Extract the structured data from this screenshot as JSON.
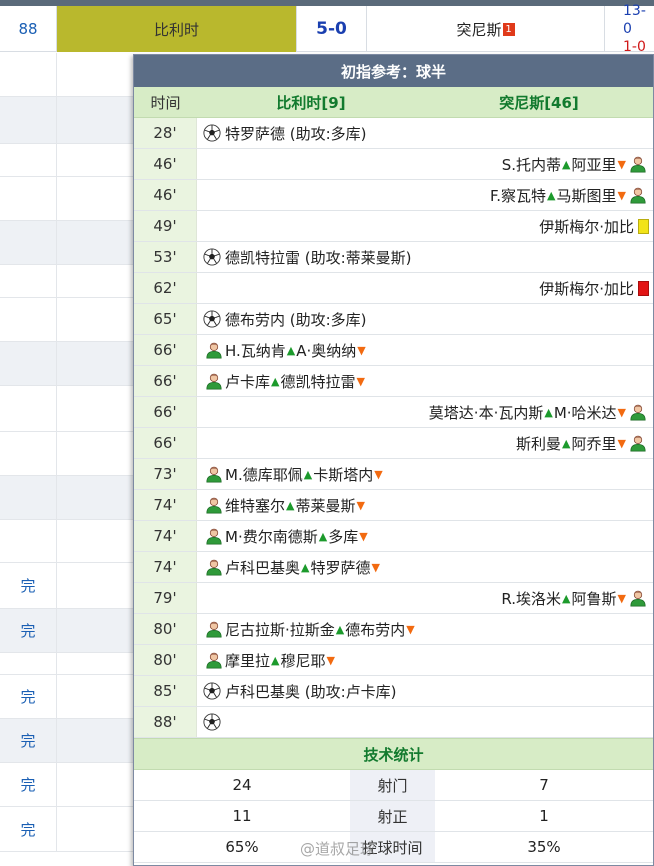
{
  "match_row": {
    "time": "88",
    "home_team": "比利时",
    "score": "5-0",
    "away_team": "突尼斯",
    "away_badge": "1",
    "half_1": "13-0",
    "half_2": "1-0"
  },
  "background_rows": [
    {
      "status": ""
    },
    {
      "status": ""
    },
    {
      "status": ""
    },
    {
      "status": ""
    },
    {
      "status": ""
    },
    {
      "status": ""
    },
    {
      "status": ""
    },
    {
      "status": ""
    },
    {
      "status": ""
    },
    {
      "status": ""
    },
    {
      "status": ""
    },
    {
      "status": ""
    },
    {
      "status": "完"
    },
    {
      "status": "完"
    },
    {
      "status": ""
    },
    {
      "status": "完"
    },
    {
      "status": "完"
    },
    {
      "status": "完"
    },
    {
      "status": "完"
    }
  ],
  "popup": {
    "title": "初指参考：球半",
    "col_time": "时间",
    "col_home": "比利时[9]",
    "col_away": "突尼斯[46]",
    "events": [
      {
        "time": "28'",
        "side": "home",
        "type": "goal",
        "text": "特罗萨德 (助攻:多库)"
      },
      {
        "time": "46'",
        "side": "away",
        "type": "sub",
        "in": "S.托内蒂",
        "out": "阿亚里"
      },
      {
        "time": "46'",
        "side": "away",
        "type": "sub",
        "in": "F.察瓦特",
        "out": "马斯图里"
      },
      {
        "time": "49'",
        "side": "away",
        "type": "yellow",
        "text": "伊斯梅尔·加比"
      },
      {
        "time": "53'",
        "side": "home",
        "type": "goal",
        "text": "德凯特拉雷 (助攻:蒂莱曼斯)"
      },
      {
        "time": "62'",
        "side": "away",
        "type": "red",
        "text": "伊斯梅尔·加比"
      },
      {
        "time": "65'",
        "side": "home",
        "type": "goal",
        "text": "德布劳内 (助攻:多库)"
      },
      {
        "time": "66'",
        "side": "home",
        "type": "sub",
        "in": "H.瓦纳肯",
        "out": "A·奥纳纳"
      },
      {
        "time": "66'",
        "side": "home",
        "type": "sub",
        "in": "卢卡库",
        "out": "德凯特拉雷"
      },
      {
        "time": "66'",
        "side": "away",
        "type": "sub",
        "in": "莫塔达·本·瓦内斯",
        "out": "M·哈米达"
      },
      {
        "time": "66'",
        "side": "away",
        "type": "sub",
        "in": "斯利曼",
        "out": "阿乔里"
      },
      {
        "time": "73'",
        "side": "home",
        "type": "sub",
        "in": "M.德库耶佩",
        "out": "卡斯塔内"
      },
      {
        "time": "74'",
        "side": "home",
        "type": "sub",
        "in": "维特塞尔",
        "out": "蒂莱曼斯"
      },
      {
        "time": "74'",
        "side": "home",
        "type": "sub",
        "in": "M·费尔南德斯",
        "out": "多库"
      },
      {
        "time": "74'",
        "side": "home",
        "type": "sub",
        "in": "卢科巴基奥",
        "out": "特罗萨德"
      },
      {
        "time": "79'",
        "side": "away",
        "type": "sub",
        "in": "R.埃洛米",
        "out": "阿鲁斯"
      },
      {
        "time": "80'",
        "side": "home",
        "type": "sub",
        "in": "尼古拉斯·拉斯金",
        "out": "德布劳内"
      },
      {
        "time": "80'",
        "side": "home",
        "type": "sub",
        "in": "摩里拉",
        "out": "穆尼耶"
      },
      {
        "time": "85'",
        "side": "home",
        "type": "goal",
        "text": "卢科巴基奥 (助攻:卢卡库)"
      },
      {
        "time": "88'",
        "side": "home",
        "type": "goal",
        "text": ""
      }
    ],
    "stats_title": "技术统计",
    "stats": [
      {
        "home": "24",
        "label": "射门",
        "away": "7"
      },
      {
        "home": "11",
        "label": "射正",
        "away": "1"
      },
      {
        "home": "65%",
        "label": "控球时间",
        "away": "35%"
      }
    ]
  },
  "watermark": "@道叔足球",
  "icons": {
    "goal": "soccer-ball-icon",
    "sub": "substitution-person-icon",
    "up": "arrow-up-icon",
    "down": "arrow-down-icon"
  },
  "colors": {
    "home_highlight": "#b9b82d",
    "popup_title_bg": "#5b6d86",
    "header_green": "#127a2e",
    "sub_in": "#1c9a2c",
    "sub_out": "#f26a10"
  }
}
